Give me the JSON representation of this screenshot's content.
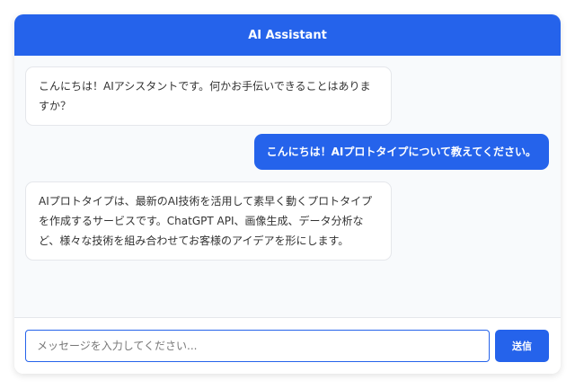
{
  "header": {
    "title": "AI Assistant"
  },
  "messages": [
    {
      "role": "assistant",
      "text": "こんにちは！AIアシスタントです。何かお手伝いできることはありますか？"
    },
    {
      "role": "user",
      "text": "こんにちは！AIプロトタイプについて教えてください。"
    },
    {
      "role": "assistant",
      "text": "AIプロトタイプは、最新のAI技術を活用して素早く動くプロトタイプを作成するサービスです。ChatGPT API、画像生成、データ分析など、様々な技術を組み合わせてお客様のアイデアを形にします。"
    }
  ],
  "input": {
    "placeholder": "メッセージを入力してください...",
    "value": ""
  },
  "send_button": {
    "label": "送信"
  },
  "colors": {
    "accent": "#2563eb",
    "background": "#f8fafc",
    "assistant_bubble": "#ffffff",
    "text": "#333333"
  }
}
